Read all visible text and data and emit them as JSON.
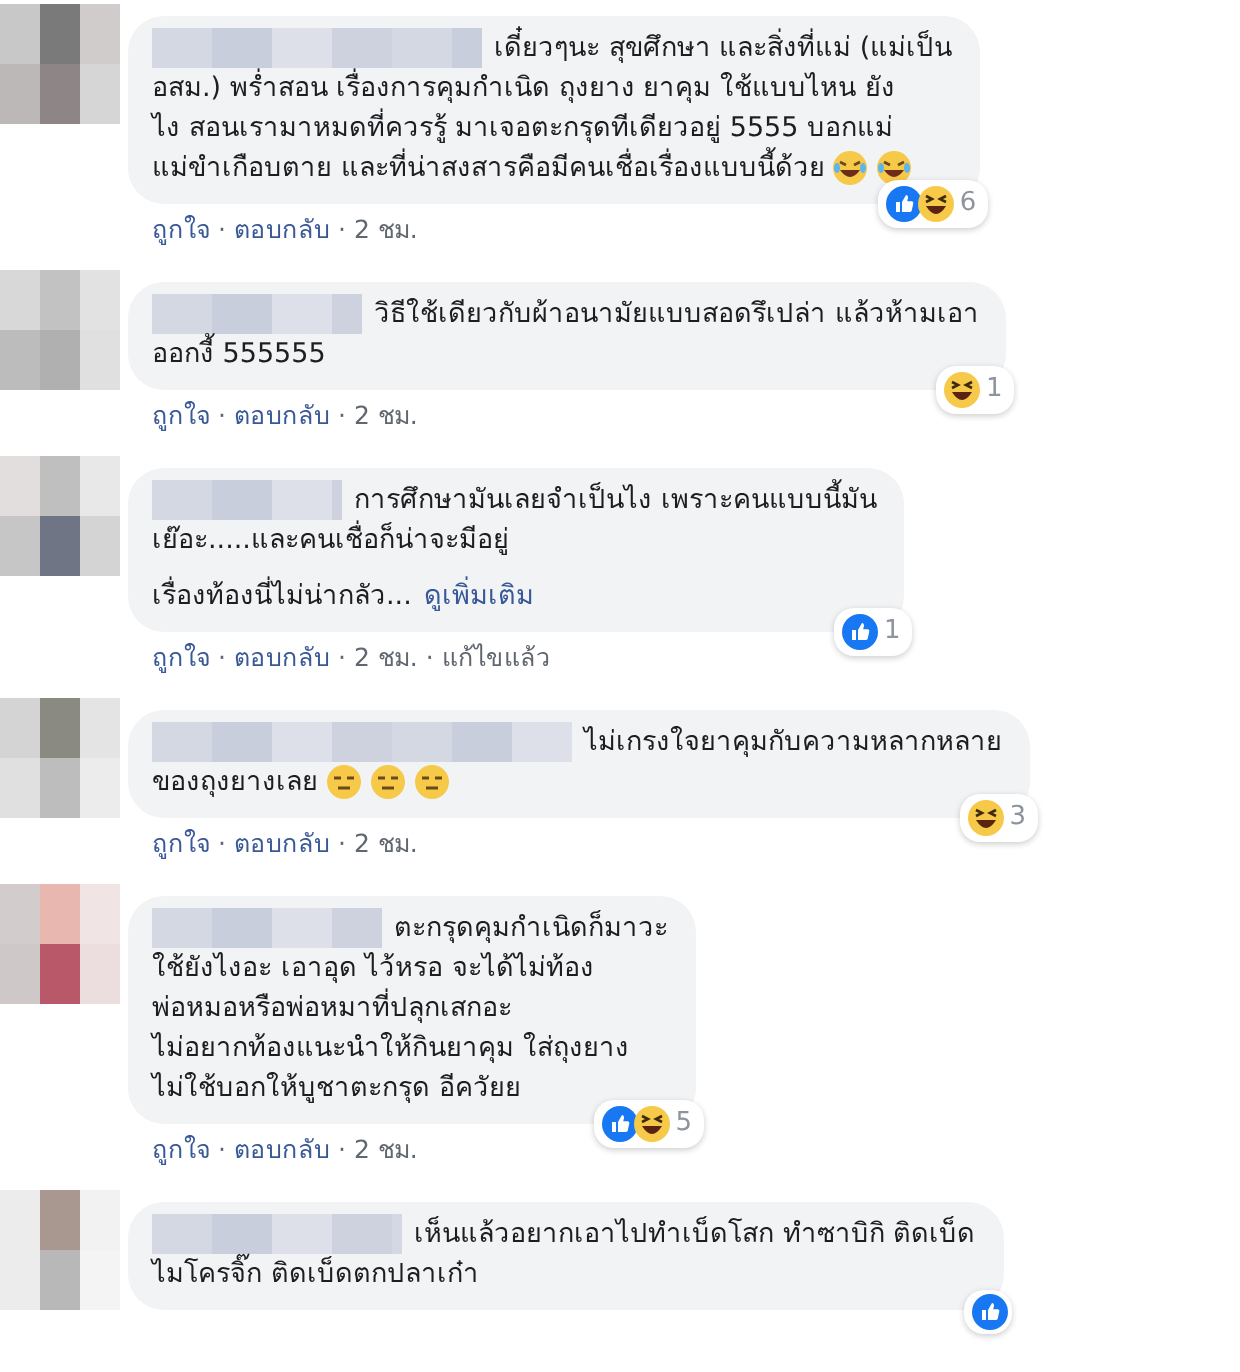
{
  "comments": [
    {
      "avatar": {
        "kind": "picture"
      },
      "name": {
        "kind": "redacted"
      },
      "lines": [
        "เดี๋ยวๆนะ สุขศึกษา และสิ่งที่แม่ (แม่เป็น",
        "อสม.) พร่ำสอน เรื่องการคุมกำเนิด ถุงยาง ยาคุม ใช้แบบไหน ยัง",
        "ไง สอนเรามาหมดที่ควรรู้ มาเจอตะกรุดทีเดียวอยู่ 5555 บอกแม่",
        "แม่ขำเกือบตาย และที่น่าสงสารคือมีคนเชื่อเรื่องแบบนี้ด้วย"
      ],
      "emojis": [
        {
          "kind": "laugh"
        },
        {
          "kind": "laugh"
        }
      ],
      "reactions": {
        "icons": [
          {
            "kind": "like"
          },
          {
            "kind": "haha"
          }
        ],
        "count": "6"
      },
      "meta": [
        {
          "kind": "link",
          "text": "ถูกใจ"
        },
        {
          "kind": "separator",
          "text": "·"
        },
        {
          "kind": "link",
          "text": "ตอบกลับ"
        },
        {
          "kind": "separator",
          "text": "·"
        },
        {
          "kind": "time",
          "text": "2 ชม."
        }
      ]
    },
    {
      "avatar": {
        "kind": "picture"
      },
      "name": {
        "kind": "redacted"
      },
      "lines": [
        "วิธีใช้เดียวกับผ้าอนามัยแบบสอดรึเปล่า แล้วห้ามเอา",
        "ออกงี้ 555555"
      ],
      "reactions": {
        "icons": [
          {
            "kind": "haha"
          }
        ],
        "count": "1"
      },
      "meta": [
        {
          "kind": "link",
          "text": "ถูกใจ"
        },
        {
          "kind": "separator",
          "text": "·"
        },
        {
          "kind": "link",
          "text": "ตอบกลับ"
        },
        {
          "kind": "separator",
          "text": "·"
        },
        {
          "kind": "time",
          "text": "2 ชม."
        }
      ]
    },
    {
      "avatar": {
        "kind": "picture"
      },
      "name": {
        "kind": "redacted"
      },
      "lines": [
        "การศึกษามันเลยจำเป็นไง เพราะคนแบบนี้มัน",
        "เย๊อะ.....และคนเชื่อก็น่าจะมีอยู่"
      ],
      "more": {
        "text": "เรื่องท้องนี่ไม่น่ากลัว...",
        "link": "ดูเพิ่มเติม"
      },
      "reactions": {
        "icons": [
          {
            "kind": "like"
          }
        ],
        "count": "1"
      },
      "meta": [
        {
          "kind": "link",
          "text": "ถูกใจ"
        },
        {
          "kind": "separator",
          "text": "·"
        },
        {
          "kind": "link",
          "text": "ตอบกลับ"
        },
        {
          "kind": "separator",
          "text": "·"
        },
        {
          "kind": "time",
          "text": "2 ชม."
        },
        {
          "kind": "separator",
          "text": "·"
        },
        {
          "kind": "edited",
          "text": "แก้ไขแล้ว"
        }
      ]
    },
    {
      "avatar": {
        "kind": "picture"
      },
      "name": {
        "kind": "redacted"
      },
      "lines": [
        "ไม่เกรงใจยาคุมกับความหลากหลาย",
        "ของถุงยางเลย"
      ],
      "emojis": [
        {
          "kind": "meh"
        },
        {
          "kind": "meh"
        },
        {
          "kind": "meh"
        }
      ],
      "reactions": {
        "icons": [
          {
            "kind": "haha"
          }
        ],
        "count": "3"
      },
      "meta": [
        {
          "kind": "link",
          "text": "ถูกใจ"
        },
        {
          "kind": "separator",
          "text": "·"
        },
        {
          "kind": "link",
          "text": "ตอบกลับ"
        },
        {
          "kind": "separator",
          "text": "·"
        },
        {
          "kind": "time",
          "text": "2 ชม."
        }
      ]
    },
    {
      "avatar": {
        "kind": "picture"
      },
      "name": {
        "kind": "redacted"
      },
      "lines": [
        "ตะกรุดคุมกำเนิดก็มาวะ",
        "ใช้ยังไงอะ เอาอุด ไว้หรอ จะได้ไม่ท้อง",
        "พ่อหมอหรือพ่อหมาที่ปลุกเสกอะ",
        "ไม่อยากท้องแนะนำให้กินยาคุม ใส่ถุงยาง",
        "ไม่ใช้บอกให้บูชาตะกรุด อีควัยย"
      ],
      "reactions": {
        "icons": [
          {
            "kind": "like"
          },
          {
            "kind": "haha"
          }
        ],
        "count": "5"
      },
      "meta": [
        {
          "kind": "link",
          "text": "ถูกใจ"
        },
        {
          "kind": "separator",
          "text": "·"
        },
        {
          "kind": "link",
          "text": "ตอบกลับ"
        },
        {
          "kind": "separator",
          "text": "·"
        },
        {
          "kind": "time",
          "text": "2 ชม."
        }
      ]
    },
    {
      "avatar": {
        "kind": "picture"
      },
      "name": {
        "kind": "redacted"
      },
      "lines": [
        "เห็นแล้วอยากเอาไปทำเบ็ดโสก ทำซาบิกิ ติดเบ็ด",
        "ไมโครจิ๊ก ติดเบ็ดตกปลาเก๋า"
      ],
      "reactions": {
        "icons": [
          {
            "kind": "like"
          }
        ]
      }
    }
  ]
}
